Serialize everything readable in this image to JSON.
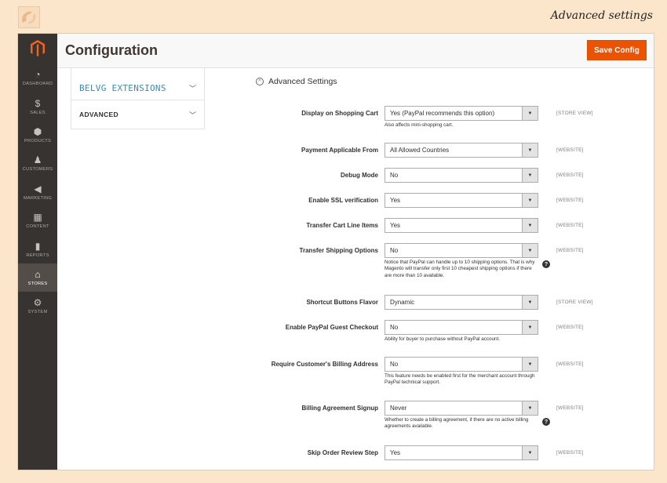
{
  "caption": "Advanced settings",
  "sidebar": [
    {
      "key": "dashboard",
      "label": "DASHBOARD",
      "icon": "dashboard-icon",
      "glyph": "◔"
    },
    {
      "key": "sales",
      "label": "SALES",
      "icon": "dollar-icon",
      "glyph": "$"
    },
    {
      "key": "products",
      "label": "PRODUCTS",
      "icon": "box-icon",
      "glyph": "⬢"
    },
    {
      "key": "customers",
      "label": "CUSTOMERS",
      "icon": "person-icon",
      "glyph": "♟"
    },
    {
      "key": "marketing",
      "label": "MARKETING",
      "icon": "megaphone-icon",
      "glyph": "◀"
    },
    {
      "key": "content",
      "label": "CONTENT",
      "icon": "layout-icon",
      "glyph": "▦"
    },
    {
      "key": "reports",
      "label": "REPORTS",
      "icon": "bar-chart-icon",
      "glyph": "▮"
    },
    {
      "key": "stores",
      "label": "STORES",
      "icon": "store-icon",
      "glyph": "⌂",
      "active": true
    },
    {
      "key": "system",
      "label": "SYSTEM",
      "icon": "gear-icon",
      "glyph": "⚙"
    }
  ],
  "header": {
    "title": "Configuration",
    "save_label": "Save Config"
  },
  "config_tabs": [
    {
      "label": "BELVG EXTENSIONS"
    },
    {
      "label": "ADVANCED"
    }
  ],
  "section": {
    "title": "Advanced Settings"
  },
  "settings": [
    {
      "label": "Display on Shopping Cart",
      "value": "Yes (PayPal recommends this option)",
      "scope": "[STORE VIEW]",
      "note": "Also affects mini-shopping cart.",
      "help": false
    },
    {
      "label": "Payment Applicable From",
      "value": "All Allowed Countries",
      "scope": "[WEBSITE]",
      "note": "",
      "help": false
    },
    {
      "label": "Debug Mode",
      "value": "No",
      "scope": "[WEBSITE]",
      "note": "",
      "help": false
    },
    {
      "label": "Enable SSL verification",
      "value": "Yes",
      "scope": "[WEBSITE]",
      "note": "",
      "help": false
    },
    {
      "label": "Transfer Cart Line Items",
      "value": "Yes",
      "scope": "[WEBSITE]",
      "note": "",
      "help": false
    },
    {
      "label": "Transfer Shipping Options",
      "value": "No",
      "scope": "[WEBSITE]",
      "note": "Notice that PayPal can handle up to 10 shipping options. That is why Magento will transfer only first 10 cheapest shipping options if there are more than 10 available.",
      "help": true
    },
    {
      "label": "Shortcut Buttons Flavor",
      "value": "Dynamic",
      "scope": "[STORE VIEW]",
      "note": "",
      "help": false
    },
    {
      "label": "Enable PayPal Guest Checkout",
      "value": "No",
      "scope": "[WEBSITE]",
      "note": "Ability for buyer to purchase without PayPal account.",
      "help": false
    },
    {
      "label": "Require Customer's Billing Address",
      "value": "No",
      "scope": "[WEBSITE]",
      "note": "This feature needs be enabled first for the merchant account through PayPal technical support.",
      "help": false
    },
    {
      "label": "Billing Agreement Signup",
      "value": "Never",
      "scope": "[WEBSITE]",
      "note": "Whether to create a billing agreement, if there are no active billing agreements available.",
      "help": true
    },
    {
      "label": "Skip Order Review Step",
      "value": "Yes",
      "scope": "[WEBSITE]",
      "note": "",
      "help": false
    }
  ],
  "colors": {
    "accent": "#eb5202",
    "sidebar": "#373330",
    "page_bg": "#fbe6cc",
    "link": "#3a8eb1"
  }
}
